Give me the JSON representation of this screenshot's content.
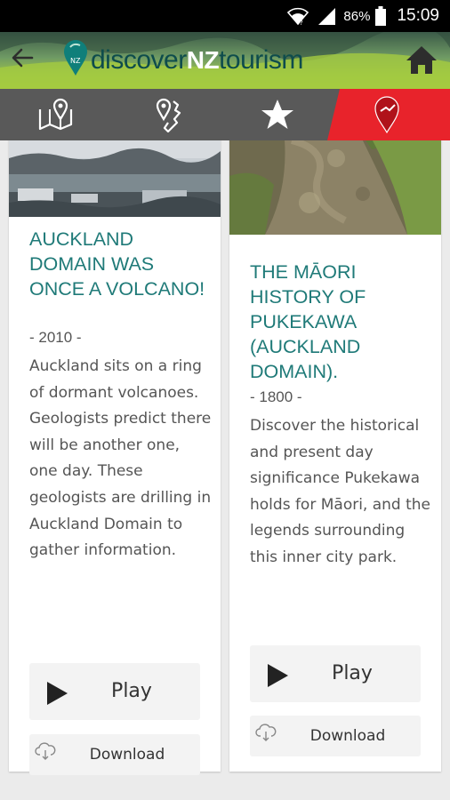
{
  "status_bar": {
    "battery_percent": "86%",
    "time": "15:09"
  },
  "header": {
    "logo_part1": "discover",
    "logo_part2": "NZ",
    "logo_part3": "tourism"
  },
  "tabs": [
    {
      "name": "map",
      "icon": "map-pin-icon",
      "active": false
    },
    {
      "name": "trails",
      "icon": "trail-pin-icon",
      "active": false
    },
    {
      "name": "favourites",
      "icon": "star-icon",
      "active": false
    },
    {
      "name": "nearby",
      "icon": "red-pin-icon",
      "active": true
    }
  ],
  "colors": {
    "active_tab": "#e8232b",
    "title_teal": "#1f7a78",
    "tab_bar": "#595959",
    "header_green": "#a6cc3e"
  },
  "cards": [
    {
      "title": "AUCKLAND DOMAIN WAS ONCE A VOLCANO!",
      "year": "- 2010 -",
      "description": "Auckland sits on a ring of dormant volcanoes. Geologists predict there will be another one, one day. These geologists are drilling in Auckland Domain to gather information.",
      "play_label": "Play",
      "download_label": "Download"
    },
    {
      "title": "THE MĀORI HISTORY OF PUKEKAWA (AUCKLAND DOMAIN).",
      "year": "- 1800 -",
      "description": "Discover the historical and present day significance Pukekawa holds for Māori, and the legends surrounding this inner city park.",
      "play_label": "Play",
      "download_label": "Download"
    }
  ]
}
